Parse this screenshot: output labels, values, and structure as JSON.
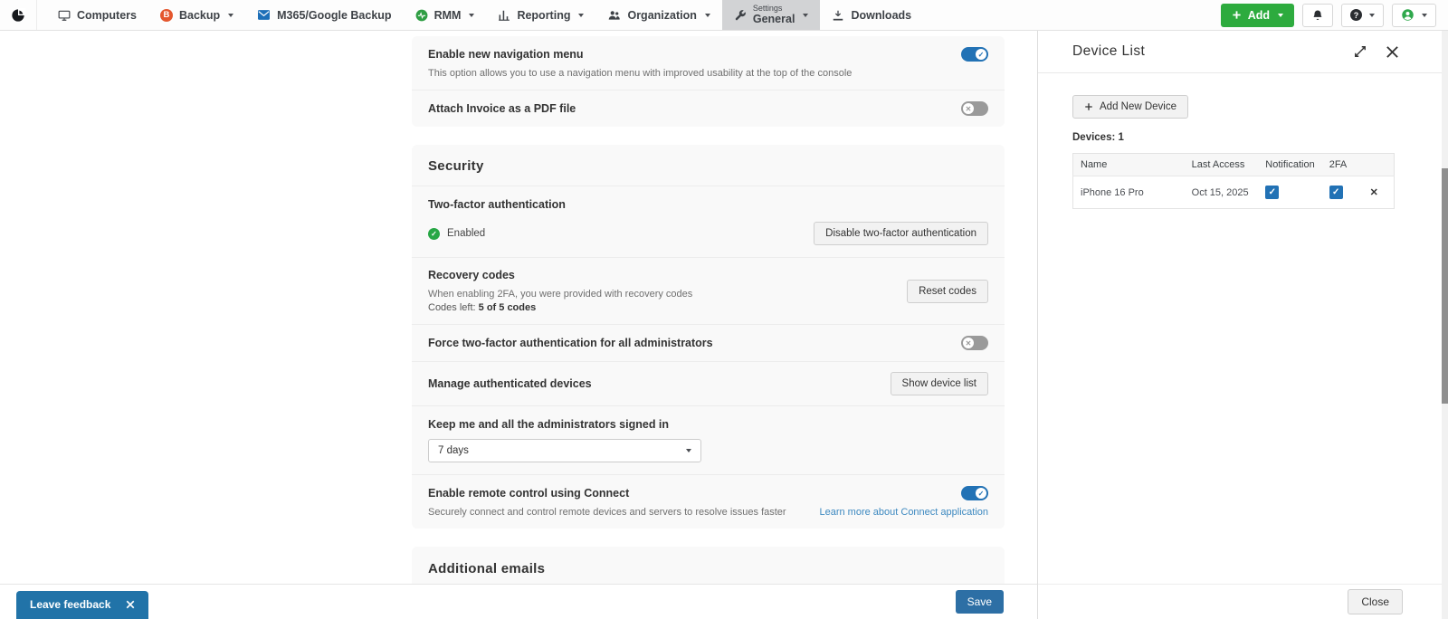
{
  "icons": {
    "check": "✓",
    "cross": "✕",
    "backup_glyph": "B",
    "help_glyph": "?"
  },
  "colors": {
    "accent_blue": "#2272b5",
    "save_blue": "#2d6fa5",
    "feedback_blue": "#2173a8",
    "link_blue": "#3d89c0",
    "add_green": "#2dab3e",
    "status_green": "#27a745",
    "backup_orange": "#e4572e",
    "envelope_blue": "#1d6fb8",
    "rmm_green": "#2f9e44",
    "active_tab_bg": "#d2d3d5"
  },
  "nav": {
    "computers": "Computers",
    "backup": "Backup",
    "m365": "M365/Google Backup",
    "rmm": "RMM",
    "reporting": "Reporting",
    "organization": "Organization",
    "settings_small": "Settings",
    "settings_active": "General",
    "downloads": "Downloads",
    "add": "Add"
  },
  "general": {
    "nav_menu": {
      "title": "Enable new navigation menu",
      "desc": "This option allows you to use a navigation menu with improved usability at the top of the console",
      "enabled": true
    },
    "invoice": {
      "title": "Attach Invoice as a PDF file",
      "enabled": false
    }
  },
  "security": {
    "title": "Security",
    "twofa": {
      "title": "Two-factor authentication",
      "status": "Enabled",
      "button": "Disable two-factor authentication"
    },
    "recovery": {
      "title": "Recovery codes",
      "desc": "When enabling 2FA, you were provided with recovery codes",
      "codes_left_label": "Codes left:",
      "codes_left_value": "5 of 5 codes",
      "button": "Reset codes"
    },
    "force": {
      "title": "Force two-factor authentication for all administrators",
      "enabled": false
    },
    "devices": {
      "title": "Manage authenticated devices",
      "button": "Show device list"
    },
    "signin": {
      "title": "Keep me and all the administrators signed in",
      "value": "7 days"
    },
    "connect": {
      "title": "Enable remote control using Connect",
      "desc": "Securely connect and control remote devices and servers to resolve issues faster",
      "link": "Learn more about Connect application",
      "enabled": true
    }
  },
  "additional_emails": {
    "title": "Additional emails"
  },
  "footer": {
    "save": "Save",
    "feedback": "Leave feedback"
  },
  "device_list": {
    "title": "Device List",
    "add_button": "Add New Device",
    "count_label": "Devices: 1",
    "table": {
      "headers": [
        "Name",
        "Last Access",
        "Notification",
        "2FA"
      ],
      "rows": [
        {
          "name": "iPhone 16 Pro",
          "last_access": "Oct 15, 2025",
          "notification": true,
          "twofa": true
        }
      ]
    },
    "close": "Close"
  }
}
